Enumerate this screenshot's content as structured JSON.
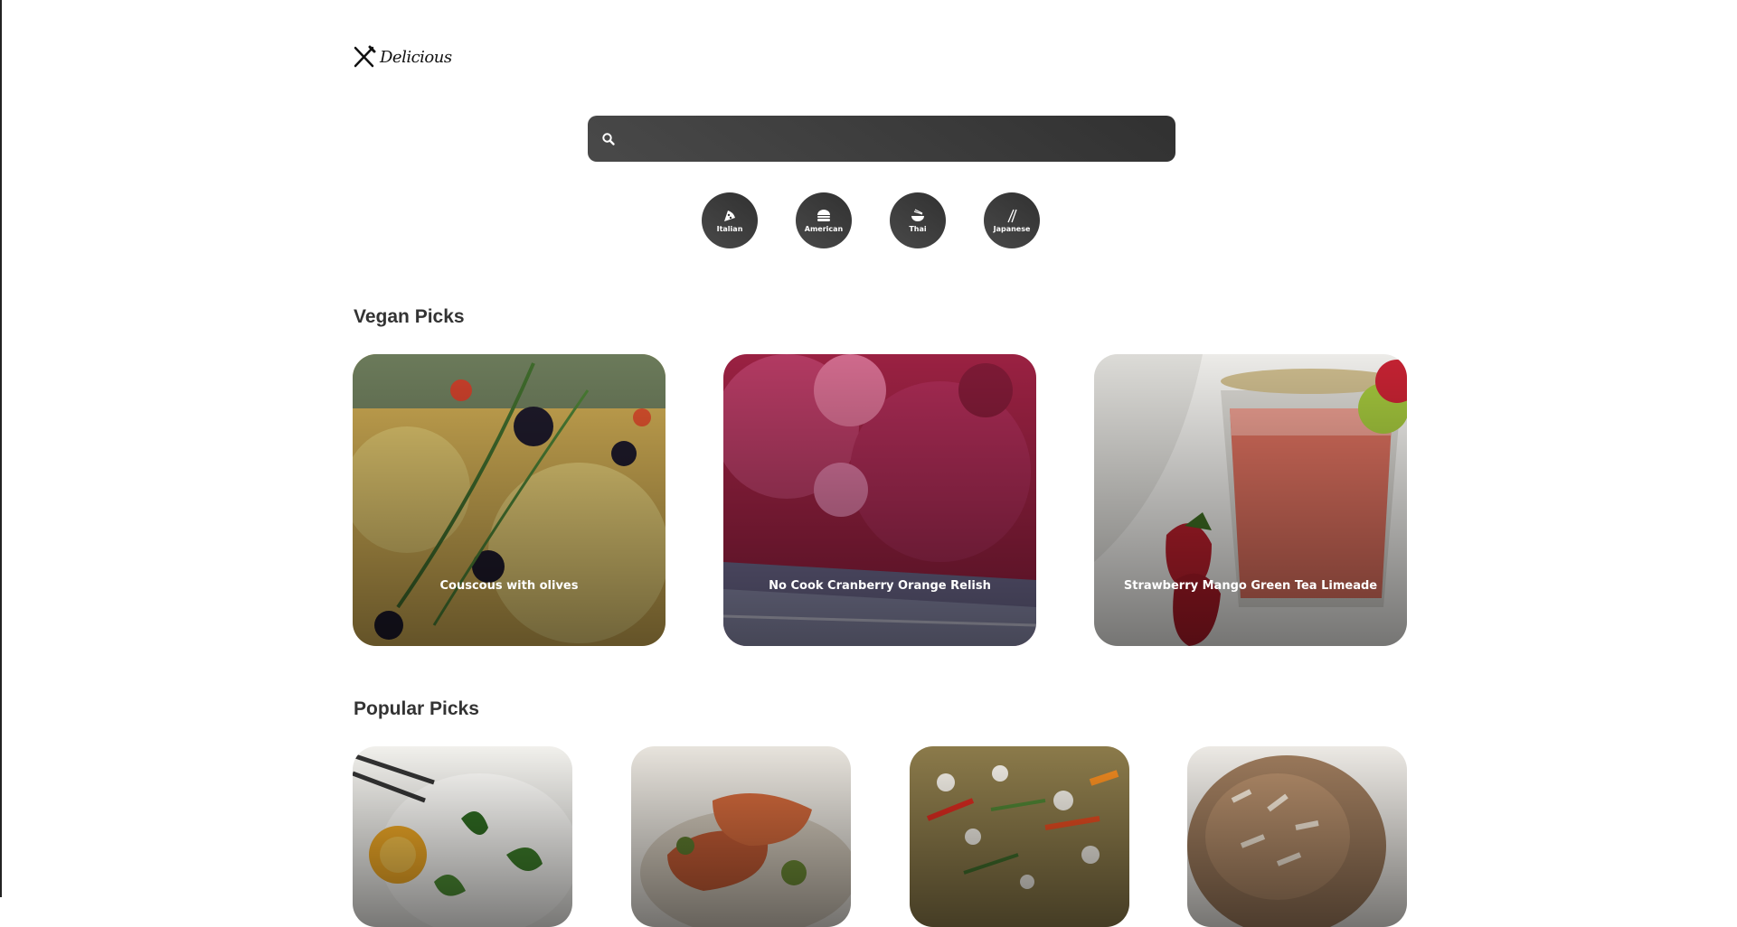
{
  "app": {
    "name": "Delicious"
  },
  "search": {
    "value": "",
    "placeholder": ""
  },
  "cuisines": [
    {
      "label": "Italian",
      "icon": "pizza-icon"
    },
    {
      "label": "American",
      "icon": "burger-icon"
    },
    {
      "label": "Thai",
      "icon": "noodle-bowl-icon"
    },
    {
      "label": "Japanese",
      "icon": "chopsticks-icon"
    }
  ],
  "vegan": {
    "heading": "Vegan Picks",
    "items": [
      {
        "title": "Couscous with olives"
      },
      {
        "title": "No Cook Cranberry Orange Relish"
      },
      {
        "title": "Strawberry Mango Green Tea Limeade"
      }
    ]
  },
  "popular": {
    "heading": "Popular Picks",
    "items": [
      {
        "title": ""
      },
      {
        "title": ""
      },
      {
        "title": ""
      },
      {
        "title": ""
      }
    ]
  },
  "colors": {
    "dark_gradient_start": "#494949",
    "dark_gradient_end": "#313131",
    "heading_text": "#333333",
    "background": "#ffffff"
  }
}
